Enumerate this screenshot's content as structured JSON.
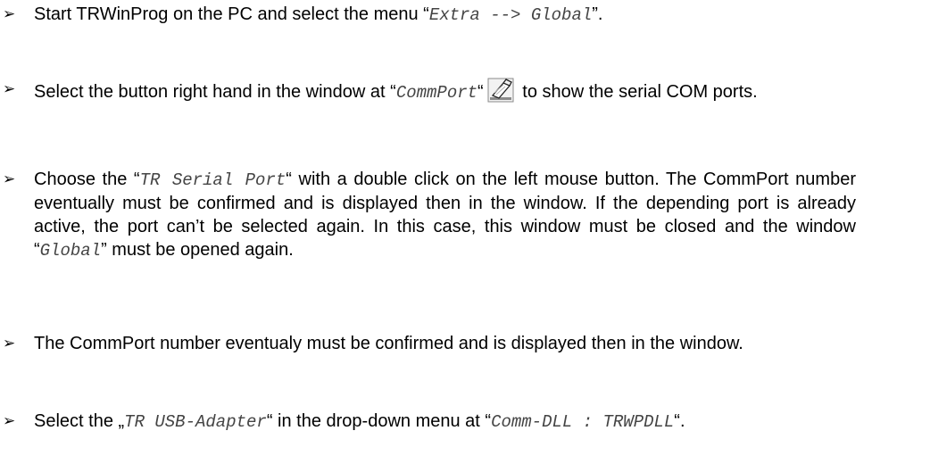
{
  "bullet_glyph": "➢",
  "steps": [
    {
      "t1": "Start TRWinProg on the PC and select the menu “",
      "c1": "Extra --> Global",
      "t2": "”."
    },
    {
      "t1": "Select the button right hand in the window at “",
      "c1": "CommPort",
      "t2": "“",
      "icon": "port-selector-button-icon",
      "t3": " to show the serial COM ports."
    },
    {
      "t1": "Choose the “",
      "c1": "TR Serial Port",
      "t2": "“ with a double click on the left mouse button. The CommPort number eventually must be confirmed and is displayed then in the window. If the depending port is already active, the port can’t be selected again. In this case, this window must be closed and the window “",
      "c2": "Global",
      "t3": "” must be opened again."
    },
    {
      "t1": "The CommPort number eventualy must be confirmed and is displayed then in the window."
    },
    {
      "t1": "Select the „",
      "c1": "TR USB-Adapter",
      "t2": "“ in the drop-down menu at “",
      "c2": "Comm-DLL : TRWPDLL",
      "t3": "“."
    }
  ]
}
